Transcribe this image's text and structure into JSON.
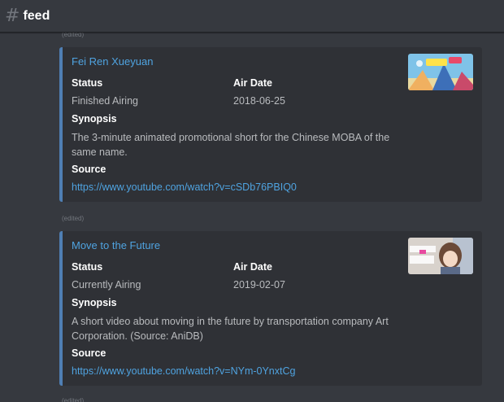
{
  "header": {
    "hash_symbol": "#",
    "channel_name": "feed"
  },
  "edited_label": "(edited)",
  "labels": {
    "status": "Status",
    "air_date": "Air Date",
    "synopsis": "Synopsis",
    "source": "Source"
  },
  "embeds": [
    {
      "title": "Fei Ren Xueyuan",
      "status": "Finished Airing",
      "air_date": "2018-06-25",
      "synopsis": "The 3-minute animated promotional short for the Chinese MOBA of the same name.",
      "source": "https://www.youtube.com/watch?v=cSDb76PBIQ0"
    },
    {
      "title": "Move to the Future",
      "status": "Currently Airing",
      "air_date": "2019-02-07",
      "synopsis": "A short video about moving in the future by transportation company Art Corporation. (Source: AniDB)",
      "source": "https://www.youtube.com/watch?v=NYm-0YnxtCg"
    }
  ],
  "colors": {
    "background": "#36393f",
    "embed_background": "#2f3136",
    "embed_border": "#4f7fb4",
    "link": "#4fa3e0"
  }
}
